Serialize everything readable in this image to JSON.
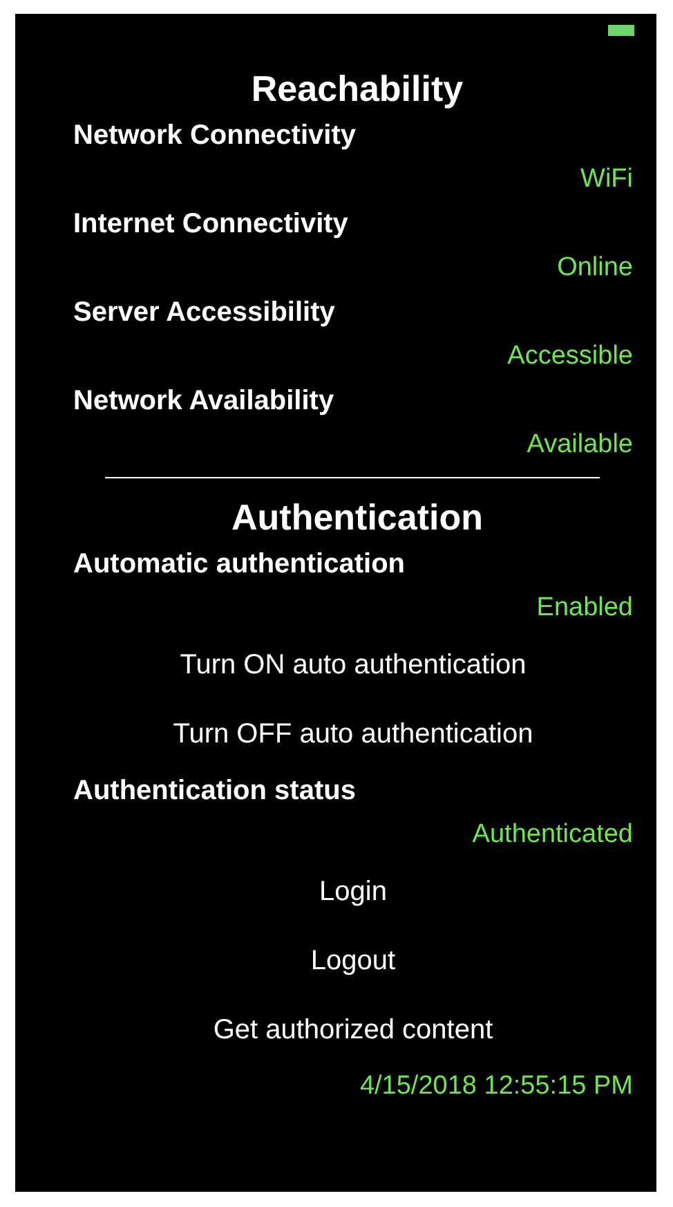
{
  "sections": [
    {
      "title": "Reachability",
      "items": [
        {
          "kind": "label",
          "text": "Network Connectivity"
        },
        {
          "kind": "value",
          "text": "WiFi"
        },
        {
          "kind": "label",
          "text": "Internet Connectivity"
        },
        {
          "kind": "value",
          "text": "Online"
        },
        {
          "kind": "label",
          "text": "Server Accessibility"
        },
        {
          "kind": "value",
          "text": "Accessible"
        },
        {
          "kind": "label",
          "text": "Network Availability"
        },
        {
          "kind": "value",
          "text": "Available"
        }
      ]
    },
    {
      "title": "Authentication",
      "items": [
        {
          "kind": "label",
          "text": "Automatic authentication"
        },
        {
          "kind": "value",
          "text": "Enabled"
        },
        {
          "kind": "button",
          "text": "Turn ON auto authentication"
        },
        {
          "kind": "button",
          "text": "Turn OFF auto authentication"
        },
        {
          "kind": "label",
          "text": "Authentication status"
        },
        {
          "kind": "value",
          "text": "Authenticated"
        },
        {
          "kind": "button",
          "text": "Login"
        },
        {
          "kind": "button",
          "text": "Logout"
        },
        {
          "kind": "button",
          "text": "Get authorized content"
        },
        {
          "kind": "value",
          "text": "4/15/2018 12:55:15 PM"
        }
      ]
    }
  ]
}
